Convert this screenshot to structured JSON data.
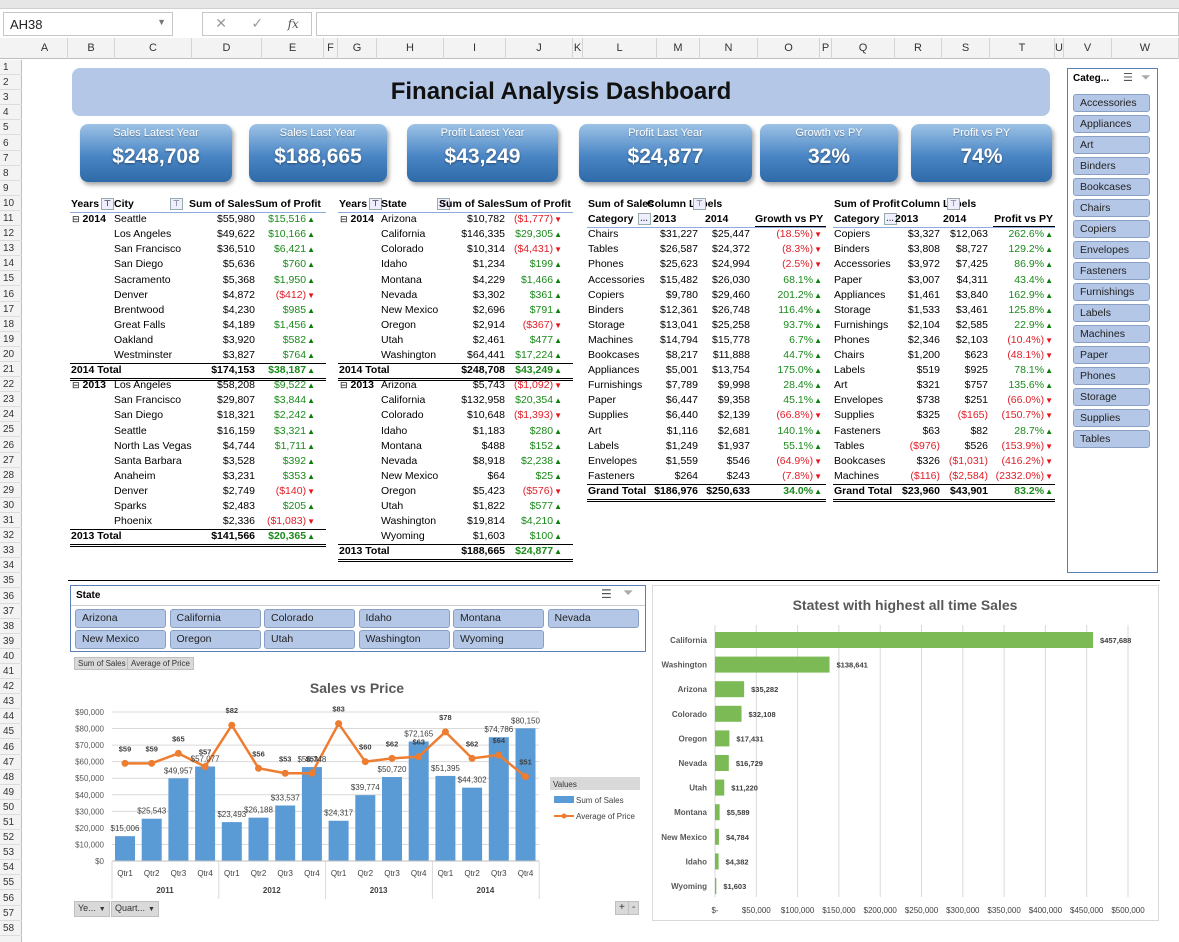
{
  "app": {
    "name_box": "AH38",
    "formula_value": "",
    "columns": [
      "A",
      "B",
      "C",
      "D",
      "E",
      "F",
      "G",
      "H",
      "I",
      "J",
      "K",
      "L",
      "M",
      "N",
      "O",
      "P",
      "Q",
      "R",
      "S",
      "T",
      "U",
      "V",
      "W"
    ],
    "rows_visible": 58
  },
  "dashboard": {
    "title": "Financial Analysis Dashboard",
    "kpis": [
      {
        "label": "Sales Latest Year",
        "value": "$248,708"
      },
      {
        "label": "Sales Last Year",
        "value": "$188,665"
      },
      {
        "label": "Profit Latest Year",
        "value": "$43,249"
      },
      {
        "label": "Profit Last Year",
        "value": "$24,877"
      },
      {
        "label": "Growth vs PY",
        "value": "32%"
      },
      {
        "label": "Profit vs PY",
        "value": "74%"
      }
    ],
    "kpi_color": "#4a86c5",
    "banner_color": "#b4c7e7"
  },
  "city_table": {
    "headers": [
      "Years",
      "City",
      "Sum of Sales",
      "Sum of Profit"
    ],
    "groups": [
      {
        "year": "2014",
        "rows": [
          [
            "Seattle",
            "$55,980",
            "$15,516"
          ],
          [
            "Los Angeles",
            "$49,622",
            "$10,166"
          ],
          [
            "San Francisco",
            "$36,510",
            "$6,421"
          ],
          [
            "San Diego",
            "$5,636",
            "$760"
          ],
          [
            "Sacramento",
            "$5,368",
            "$1,950"
          ],
          [
            "Denver",
            "$4,872",
            "($412)"
          ],
          [
            "Brentwood",
            "$4,230",
            "$985"
          ],
          [
            "Great Falls",
            "$4,189",
            "$1,456"
          ],
          [
            "Oakland",
            "$3,920",
            "$582"
          ],
          [
            "Westminster",
            "$3,827",
            "$764"
          ]
        ],
        "total_label": "2014 Total",
        "total_sales": "$174,153",
        "total_profit": "$38,187"
      },
      {
        "year": "2013",
        "rows": [
          [
            "Los Angeles",
            "$58,208",
            "$9,522"
          ],
          [
            "San Francisco",
            "$29,807",
            "$3,844"
          ],
          [
            "San Diego",
            "$18,321",
            "$2,242"
          ],
          [
            "Seattle",
            "$16,159",
            "$3,321"
          ],
          [
            "North Las Vegas",
            "$4,744",
            "$1,711"
          ],
          [
            "Santa Barbara",
            "$3,528",
            "$392"
          ],
          [
            "Anaheim",
            "$3,231",
            "$353"
          ],
          [
            "Denver",
            "$2,749",
            "($140)"
          ],
          [
            "Sparks",
            "$2,483",
            "$205"
          ],
          [
            "Phoenix",
            "$2,336",
            "($1,083)"
          ]
        ],
        "total_label": "2013 Total",
        "total_sales": "$141,566",
        "total_profit": "$20,365"
      }
    ]
  },
  "state_table": {
    "headers": [
      "Years",
      "State",
      "Sum of Sales",
      "Sum of Profit"
    ],
    "groups": [
      {
        "year": "2014",
        "rows": [
          [
            "Arizona",
            "$10,782",
            "($1,777)"
          ],
          [
            "California",
            "$146,335",
            "$29,305"
          ],
          [
            "Colorado",
            "$10,314",
            "($4,431)"
          ],
          [
            "Idaho",
            "$1,234",
            "$199"
          ],
          [
            "Montana",
            "$4,229",
            "$1,466"
          ],
          [
            "Nevada",
            "$3,302",
            "$361"
          ],
          [
            "New Mexico",
            "$2,696",
            "$791"
          ],
          [
            "Oregon",
            "$2,914",
            "($367)"
          ],
          [
            "Utah",
            "$2,461",
            "$477"
          ],
          [
            "Washington",
            "$64,441",
            "$17,224"
          ]
        ],
        "total_label": "2014 Total",
        "total_sales": "$248,708",
        "total_profit": "$43,249"
      },
      {
        "year": "2013",
        "rows": [
          [
            "Arizona",
            "$5,743",
            "($1,092)"
          ],
          [
            "California",
            "$132,958",
            "$20,354"
          ],
          [
            "Colorado",
            "$10,648",
            "($1,393)"
          ],
          [
            "Idaho",
            "$1,183",
            "$280"
          ],
          [
            "Montana",
            "$488",
            "$152"
          ],
          [
            "Nevada",
            "$8,918",
            "$2,238"
          ],
          [
            "New Mexico",
            "$64",
            "$25"
          ],
          [
            "Oregon",
            "$5,423",
            "($576)"
          ],
          [
            "Utah",
            "$1,822",
            "$577"
          ],
          [
            "Washington",
            "$19,814",
            "$4,210"
          ],
          [
            "Wyoming",
            "$1,603",
            "$100"
          ]
        ],
        "total_label": "2013 Total",
        "total_sales": "$188,665",
        "total_profit": "$24,877"
      }
    ]
  },
  "sales_category_table": {
    "value_label": "Sum of Sales",
    "column_label": "Column Labels",
    "headers": [
      "Category",
      "2013",
      "2014",
      "Growth vs PY"
    ],
    "rows": [
      [
        "Chairs",
        "$31,227",
        "$25,447",
        "(18.5%)"
      ],
      [
        "Tables",
        "$26,587",
        "$24,372",
        "(8.3%)"
      ],
      [
        "Phones",
        "$25,623",
        "$24,994",
        "(2.5%)"
      ],
      [
        "Accessories",
        "$15,482",
        "$26,030",
        "68.1%"
      ],
      [
        "Copiers",
        "$9,780",
        "$29,460",
        "201.2%"
      ],
      [
        "Binders",
        "$12,361",
        "$26,748",
        "116.4%"
      ],
      [
        "Storage",
        "$13,041",
        "$25,258",
        "93.7%"
      ],
      [
        "Machines",
        "$14,794",
        "$15,778",
        "6.7%"
      ],
      [
        "Bookcases",
        "$8,217",
        "$11,888",
        "44.7%"
      ],
      [
        "Appliances",
        "$5,001",
        "$13,754",
        "175.0%"
      ],
      [
        "Furnishings",
        "$7,789",
        "$9,998",
        "28.4%"
      ],
      [
        "Paper",
        "$6,447",
        "$9,358",
        "45.1%"
      ],
      [
        "Supplies",
        "$6,440",
        "$2,139",
        "(66.8%)"
      ],
      [
        "Art",
        "$1,116",
        "$2,681",
        "140.1%"
      ],
      [
        "Labels",
        "$1,249",
        "$1,937",
        "55.1%"
      ],
      [
        "Envelopes",
        "$1,559",
        "$546",
        "(64.9%)"
      ],
      [
        "Fasteners",
        "$264",
        "$243",
        "(7.8%)"
      ]
    ],
    "total": [
      "Grand Total",
      "$186,976",
      "$250,633",
      "34.0%"
    ]
  },
  "profit_category_table": {
    "value_label": "Sum of Profit",
    "column_label": "Column Labels",
    "headers": [
      "Category",
      "2013",
      "2014",
      "Profit vs PY"
    ],
    "rows": [
      [
        "Copiers",
        "$3,327",
        "$12,063",
        "262.6%"
      ],
      [
        "Binders",
        "$3,808",
        "$8,727",
        "129.2%"
      ],
      [
        "Accessories",
        "$3,972",
        "$7,425",
        "86.9%"
      ],
      [
        "Paper",
        "$3,007",
        "$4,311",
        "43.4%"
      ],
      [
        "Appliances",
        "$1,461",
        "$3,840",
        "162.9%"
      ],
      [
        "Storage",
        "$1,533",
        "$3,461",
        "125.8%"
      ],
      [
        "Furnishings",
        "$2,104",
        "$2,585",
        "22.9%"
      ],
      [
        "Phones",
        "$2,346",
        "$2,103",
        "(10.4%)"
      ],
      [
        "Chairs",
        "$1,200",
        "$623",
        "(48.1%)"
      ],
      [
        "Labels",
        "$519",
        "$925",
        "78.1%"
      ],
      [
        "Art",
        "$321",
        "$757",
        "135.6%"
      ],
      [
        "Envelopes",
        "$738",
        "$251",
        "(66.0%)"
      ],
      [
        "Supplies",
        "$325",
        "($165)",
        "(150.7%)"
      ],
      [
        "Fasteners",
        "$63",
        "$82",
        "28.7%"
      ],
      [
        "Tables",
        "($976)",
        "$526",
        "(153.9%)"
      ],
      [
        "Bookcases",
        "$326",
        "($1,031)",
        "(416.2%)"
      ],
      [
        "Machines",
        "($116)",
        "($2,584)",
        "(2332.0%)"
      ]
    ],
    "total": [
      "Grand Total",
      "$23,960",
      "$43,901",
      "83.2%"
    ]
  },
  "category_slicer": {
    "title": "Categ...",
    "items": [
      "Accessories",
      "Appliances",
      "Art",
      "Binders",
      "Bookcases",
      "Chairs",
      "Copiers",
      "Envelopes",
      "Fasteners",
      "Furnishings",
      "Labels",
      "Machines",
      "Paper",
      "Phones",
      "Storage",
      "Supplies",
      "Tables"
    ]
  },
  "state_slicer": {
    "title": "State",
    "items": [
      "Arizona",
      "California",
      "Colorado",
      "Idaho",
      "Montana",
      "Nevada",
      "New Mexico",
      "Oregon",
      "Utah",
      "Washington",
      "Wyoming"
    ]
  },
  "pivot_chart": {
    "value_buttons": [
      "Sum of Sales",
      "Average of Price"
    ],
    "axis_buttons": [
      "Ye...",
      "Quart..."
    ],
    "zoom_buttons": [
      "+",
      "-"
    ],
    "legend_title": "Values"
  },
  "chart_data": [
    {
      "type": "bar+line",
      "title": "Sales vs Price",
      "categories": [
        "Qtr1",
        "Qtr2",
        "Qtr3",
        "Qtr4",
        "Qtr1",
        "Qtr2",
        "Qtr3",
        "Qtr4",
        "Qtr1",
        "Qtr2",
        "Qtr3",
        "Qtr4",
        "Qtr1",
        "Qtr2",
        "Qtr3",
        "Qtr4"
      ],
      "category_groups": [
        "2011",
        "2012",
        "2013",
        "2014"
      ],
      "series": [
        {
          "name": "Sum of Sales",
          "type": "bar",
          "color": "#5b9bd5",
          "values": [
            15006,
            25543,
            49957,
            57077,
            23493,
            26188,
            33537,
            56748,
            24317,
            39774,
            50720,
            72165,
            51395,
            44302,
            74786,
            80150
          ],
          "labels": [
            "$15,006",
            "$25,543",
            "$49,957",
            "$57,077",
            "$23,493",
            "$26,188",
            "$33,537",
            "$56,748",
            "$24,317",
            "$39,774",
            "$50,720",
            "$72,165",
            "$51,395",
            "$44,302",
            "$74,786",
            "$80,150"
          ]
        },
        {
          "name": "Average of Price",
          "type": "line",
          "color": "#ed7d31",
          "values": [
            59,
            59,
            65,
            57,
            82,
            56,
            53,
            53,
            83,
            60,
            62,
            63,
            78,
            62,
            64,
            51
          ],
          "labels": [
            "$59",
            "$59",
            "$65",
            "$57",
            "$82",
            "$56",
            "$53",
            "$53",
            "$83",
            "$60",
            "$62",
            "$63",
            "$78",
            "$62",
            "$64",
            "$51"
          ]
        }
      ],
      "ylim": [
        0,
        90000
      ],
      "yticks": [
        "$0",
        "$10,000",
        "$20,000",
        "$30,000",
        "$40,000",
        "$50,000",
        "$60,000",
        "$70,000",
        "$80,000",
        "$90,000"
      ],
      "grid": true,
      "legend": "right"
    },
    {
      "type": "bar",
      "orientation": "horizontal",
      "title": "Statest with highest all time Sales",
      "categories": [
        "California",
        "Washington",
        "Arizona",
        "Colorado",
        "Oregon",
        "Nevada",
        "Utah",
        "Montana",
        "New Mexico",
        "Idaho",
        "Wyoming"
      ],
      "values": [
        457688,
        138641,
        35282,
        32108,
        17431,
        16729,
        11220,
        5589,
        4784,
        4382,
        1603
      ],
      "labels": [
        "$457,688",
        "$138,641",
        "$35,282",
        "$32,108",
        "$17,431",
        "$16,729",
        "$11,220",
        "$5,589",
        "$4,784",
        "$4,382",
        "$1,603"
      ],
      "xlim": [
        0,
        500000
      ],
      "xticks": [
        "$-",
        "$50,000",
        "$100,000",
        "$150,000",
        "$200,000",
        "$250,000",
        "$300,000",
        "$350,000",
        "$400,000",
        "$450,000",
        "$500,000"
      ],
      "color": "#7cba56",
      "grid": true
    }
  ]
}
